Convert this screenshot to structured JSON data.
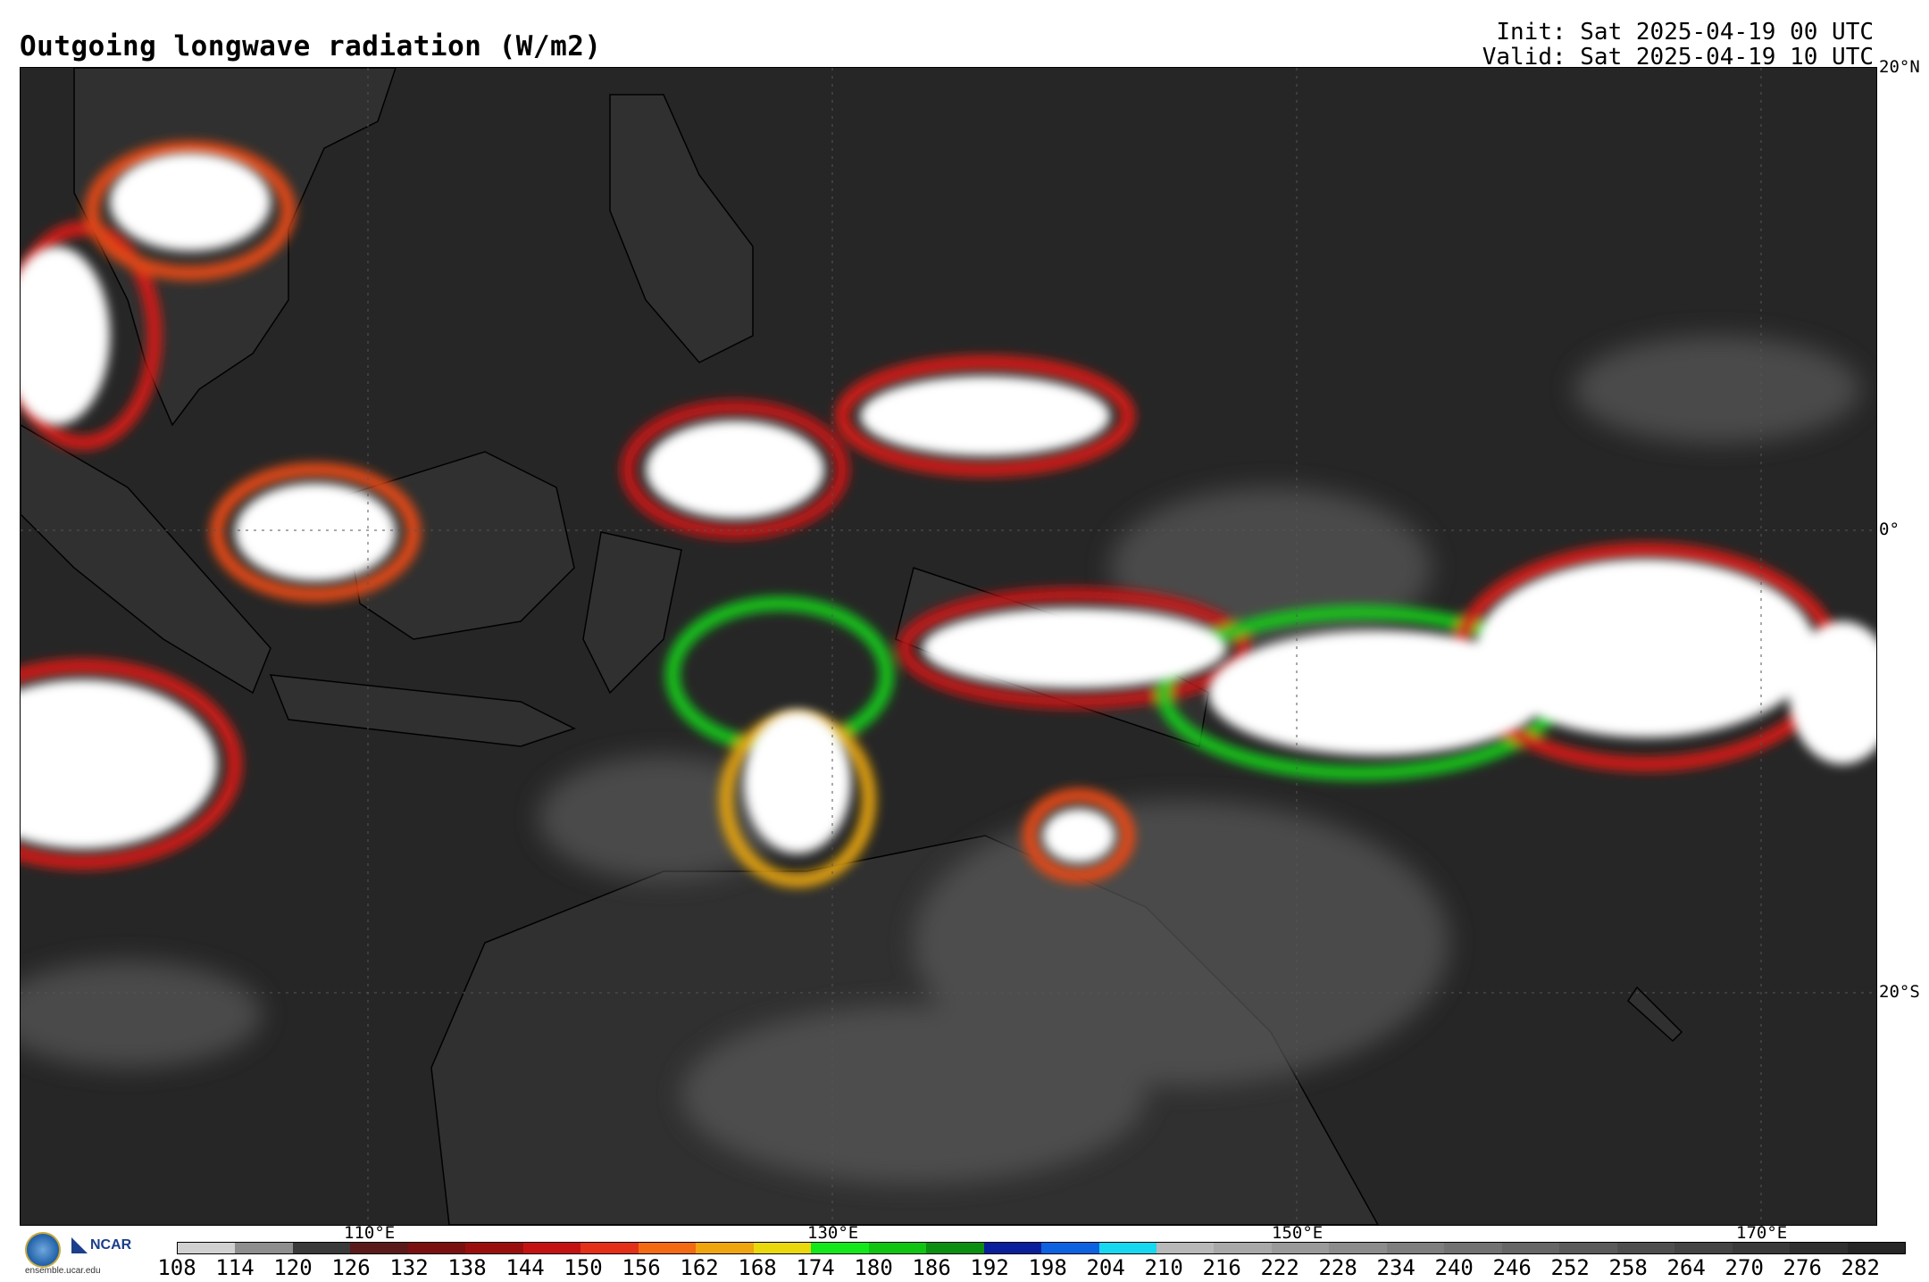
{
  "header": {
    "title": "Outgoing longwave radiation (W/m2)",
    "init": "Init: Sat 2025-04-19 00 UTC",
    "valid": "Valid: Sat 2025-04-19 10 UTC"
  },
  "map": {
    "lat_labels": [
      "20°N",
      "0°",
      "20°S"
    ],
    "lon_labels": [
      "110°E",
      "130°E",
      "150°E",
      "170°E"
    ],
    "land_color": "#3a3a3a",
    "ocean_color": "#262626",
    "cloud_color": "#ffffff"
  },
  "legend": {
    "ticks": [
      "108",
      "114",
      "120",
      "126",
      "132",
      "138",
      "144",
      "150",
      "156",
      "162",
      "168",
      "174",
      "180",
      "186",
      "192",
      "198",
      "204",
      "210",
      "216",
      "222",
      "228",
      "234",
      "240",
      "246",
      "252",
      "258",
      "264",
      "270",
      "276",
      "282"
    ],
    "colors": [
      "#d0d0d0",
      "#8e8e8e",
      "#3a3a3a",
      "#5a1a1a",
      "#7a1010",
      "#9a0e0e",
      "#c41212",
      "#e33018",
      "#f26a12",
      "#f0a40e",
      "#e8d80c",
      "#12e81a",
      "#10c412",
      "#0c8f10",
      "#0a1f9c",
      "#0c62e0",
      "#16d8f0",
      "#b8b8b8",
      "#a8a8a8",
      "#9a9a9a",
      "#8c8c8c",
      "#7e7e7e",
      "#727272",
      "#666666",
      "#5a5a5a",
      "#4e4e4e",
      "#444444",
      "#3a3a3a",
      "#303030",
      "#262626"
    ]
  },
  "branding": {
    "logo_nsf": "NSF",
    "logo_ncar": "NCAR",
    "site": "ensemble.ucar.edu"
  }
}
